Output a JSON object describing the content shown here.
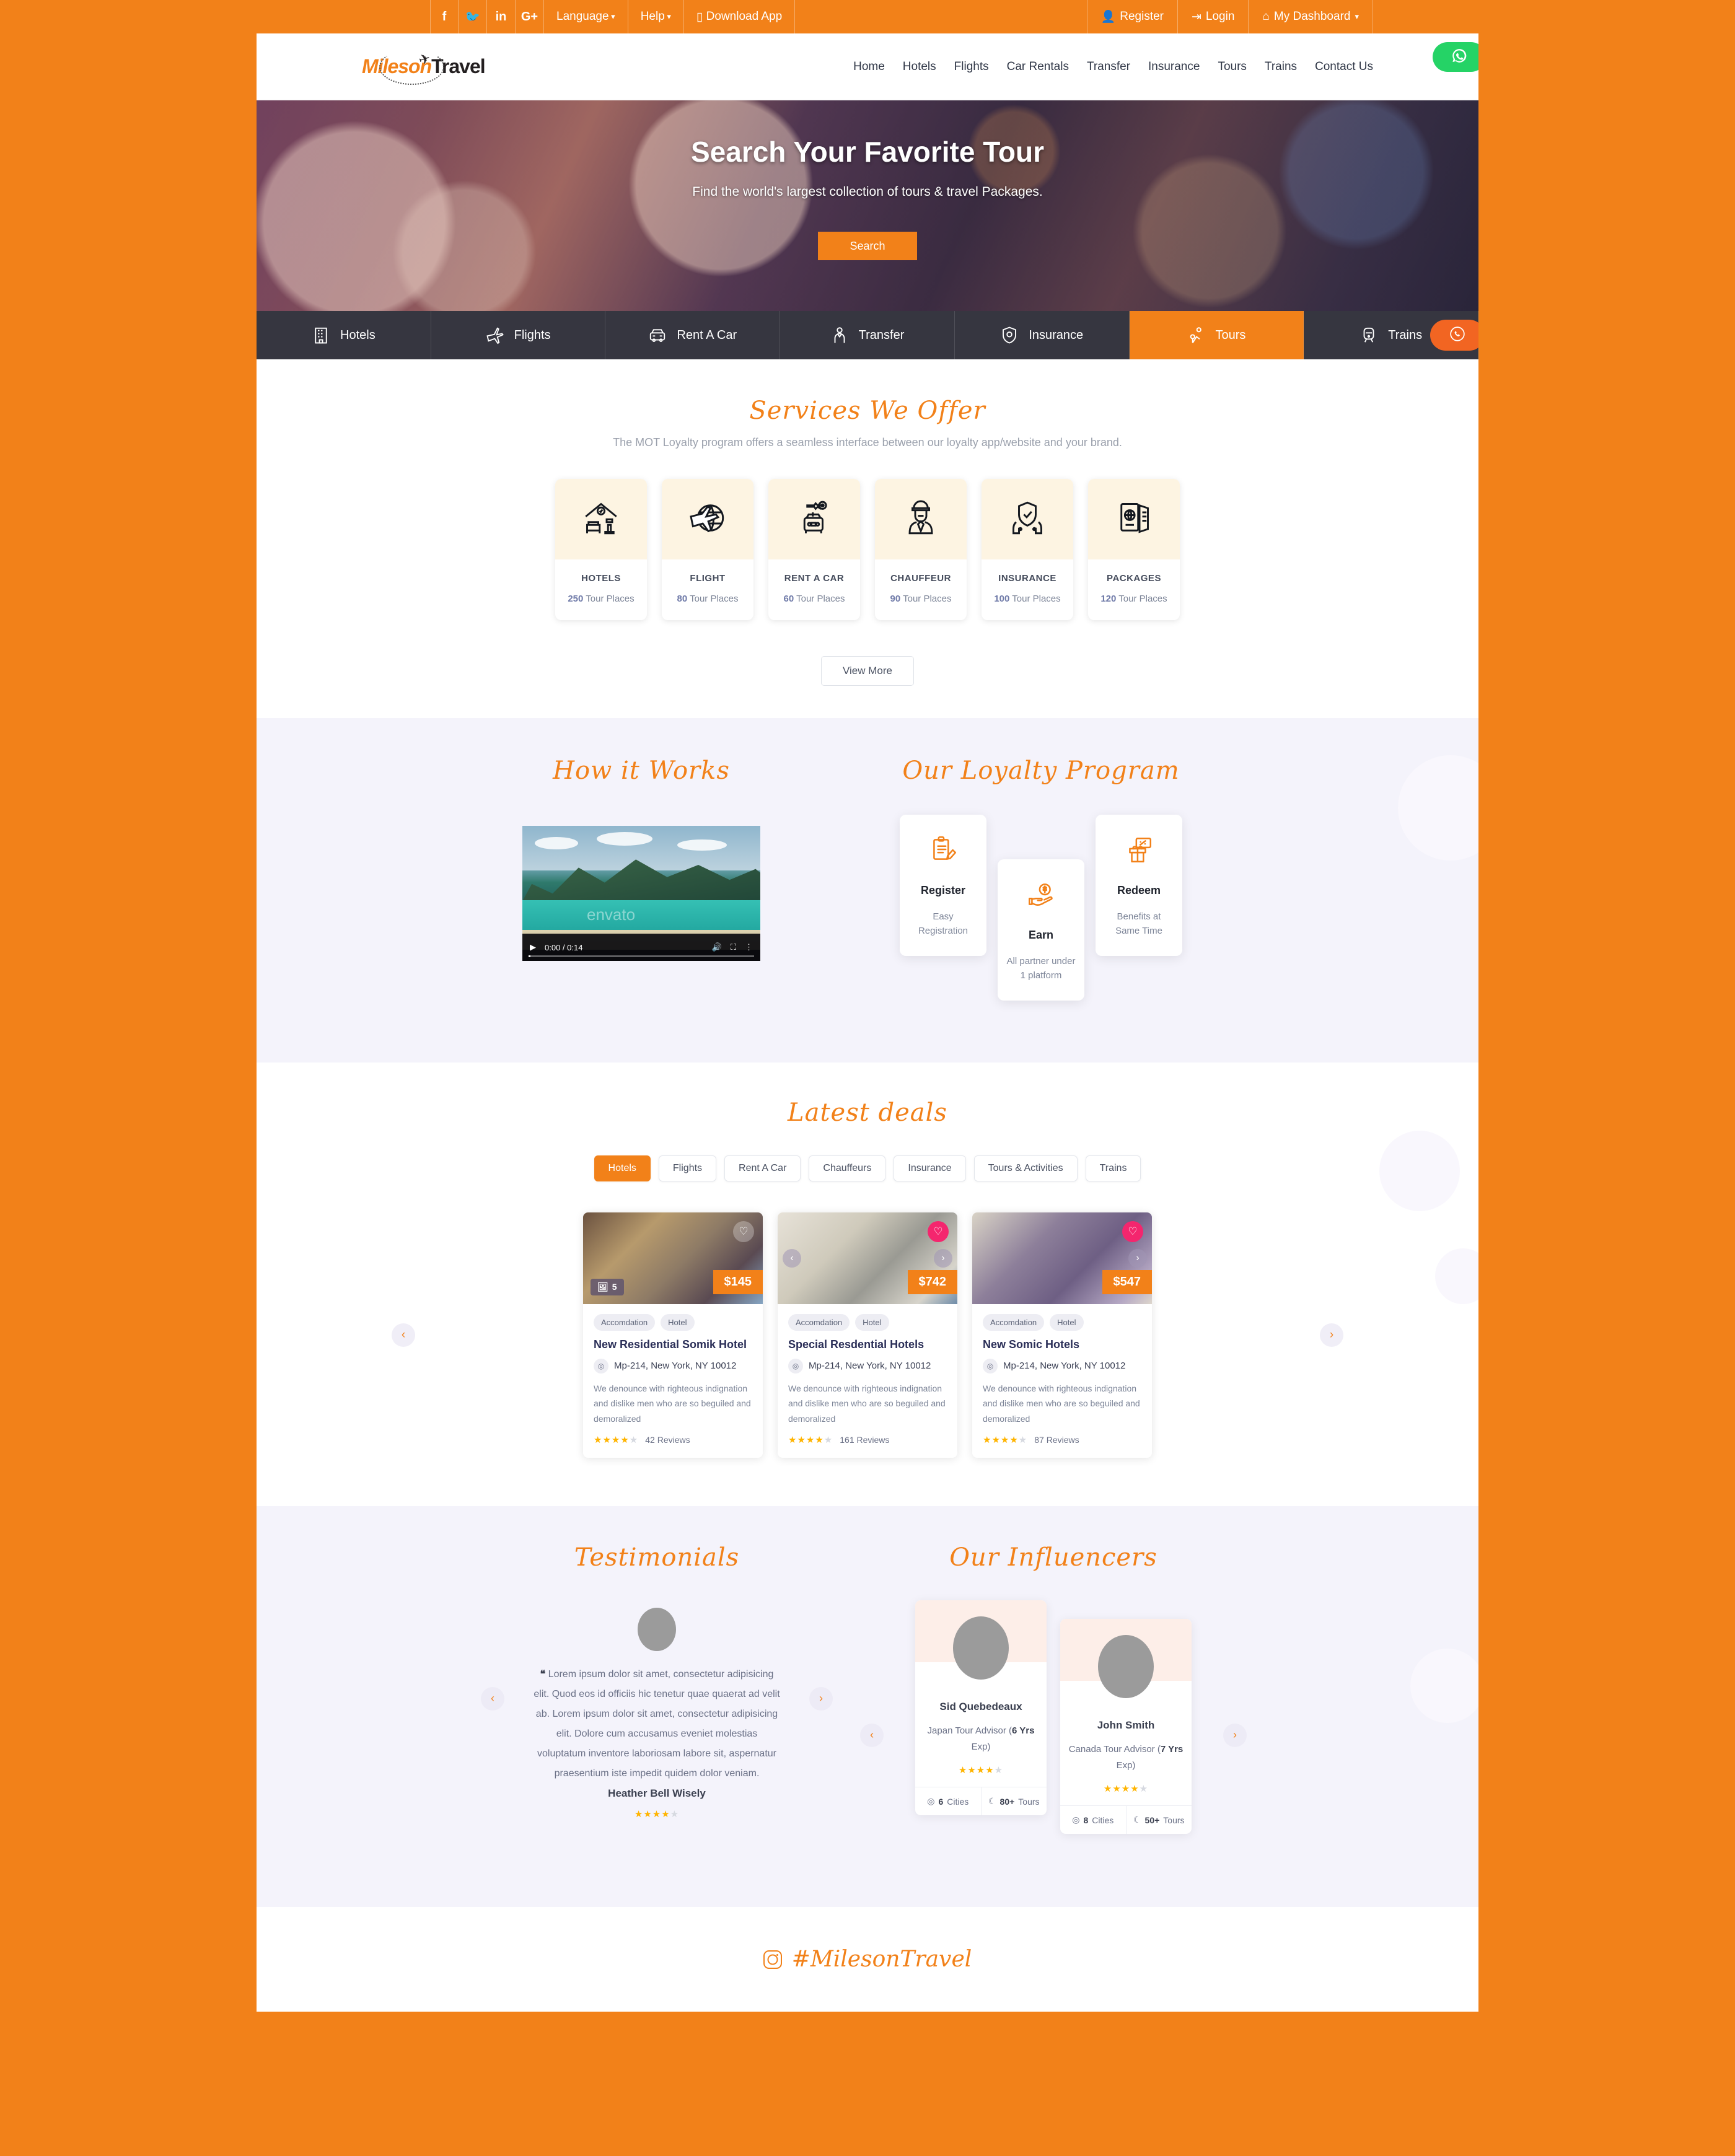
{
  "topbar": {
    "socials": [
      {
        "name": "facebook-icon",
        "glyph": "f"
      },
      {
        "name": "twitter-icon",
        "glyph": "🐦"
      },
      {
        "name": "linkedin-icon",
        "glyph": "in"
      },
      {
        "name": "google-plus-icon",
        "glyph": "G+"
      }
    ],
    "language_label": "Language",
    "help_label": "Help",
    "download_label": "Download App",
    "register_label": "Register",
    "login_label": "Login",
    "dashboard_label": "My Dashboard"
  },
  "header": {
    "logo": {
      "part1": "Miles",
      "part2": "on",
      "part3": "Travel"
    },
    "nav": [
      "Home",
      "Hotels",
      "Flights",
      "Car Rentals",
      "Transfer",
      "Insurance",
      "Tours",
      "Trains",
      "Contact Us"
    ]
  },
  "hero": {
    "title": "Search Your Favorite Tour",
    "subtitle": "Find the world's largest collection of tours & travel Packages.",
    "search_label": "Search"
  },
  "service_tabs": [
    {
      "label": "Hotels",
      "icon": "hotel-icon",
      "active": false
    },
    {
      "label": "Flights",
      "icon": "flight-icon",
      "active": false
    },
    {
      "label": "Rent A Car",
      "icon": "car-icon",
      "active": false
    },
    {
      "label": "Transfer",
      "icon": "transfer-icon",
      "active": false
    },
    {
      "label": "Insurance",
      "icon": "shield-icon",
      "active": false
    },
    {
      "label": "Tours",
      "icon": "tours-icon",
      "active": true
    },
    {
      "label": "Trains",
      "icon": "train-icon",
      "active": false
    }
  ],
  "floating": {
    "call_icon": "phone-icon",
    "whatsapp_icon": "whatsapp-icon"
  },
  "services": {
    "title": "Services We Offer",
    "subtitle": "The MOT Loyalty program offers a seamless interface between our loyalty app/website and your brand.",
    "cards": [
      {
        "name": "HOTELS",
        "count": "250",
        "unit": "Tour Places",
        "icon": "hotel-bed-icon"
      },
      {
        "name": "FLIGHT",
        "count": "80",
        "unit": "Tour Places",
        "icon": "globe-plane-icon"
      },
      {
        "name": "RENT A CAR",
        "count": "60",
        "unit": "Tour Places",
        "icon": "car-key-icon"
      },
      {
        "name": "CHAUFFEUR",
        "count": "90",
        "unit": "Tour Places",
        "icon": "chauffeur-icon"
      },
      {
        "name": "INSURANCE",
        "count": "100",
        "unit": "Tour Places",
        "icon": "shield-hands-icon"
      },
      {
        "name": "PACKAGES",
        "count": "120",
        "unit": "Tour Places",
        "icon": "passport-ticket-icon"
      }
    ],
    "view_more_label": "View More"
  },
  "how_it_works": {
    "title": "How it Works",
    "video": {
      "current_time": "0:00",
      "duration": "0:14",
      "time_label": "0:00 / 0:14",
      "watermark": "envato"
    }
  },
  "loyalty": {
    "title": "Our Loyalty Program",
    "cards": [
      {
        "title": "Register",
        "desc": "Easy Registration",
        "icon": "clipboard-pen-icon"
      },
      {
        "title": "Earn",
        "desc": "All partner under 1 platform",
        "icon": "hand-coin-icon"
      },
      {
        "title": "Redeem",
        "desc": "Benefits at Same Time",
        "icon": "gift-voucher-icon"
      }
    ]
  },
  "deals": {
    "title": "Latest deals",
    "tabs": [
      {
        "label": "Hotels",
        "active": true
      },
      {
        "label": "Flights",
        "active": false
      },
      {
        "label": "Rent A Car",
        "active": false
      },
      {
        "label": "Chauffeurs",
        "active": false
      },
      {
        "label": "Insurance",
        "active": false
      },
      {
        "label": "Tours & Activities",
        "active": false
      },
      {
        "label": "Trains",
        "active": false
      }
    ],
    "cards": [
      {
        "price": "$145",
        "photo_count": "5",
        "chips": [
          "Accomdation",
          "Hotel"
        ],
        "title": "New Residential Somik Hotel",
        "location": "Mp-214, New York, NY 10012",
        "description": "We denounce with righteous indignation and dislike men who are so beguiled and demoralized",
        "rating": 4,
        "reviews": "42 Reviews",
        "favorite": false
      },
      {
        "price": "$742",
        "photo_count": "",
        "chips": [
          "Accomdation",
          "Hotel"
        ],
        "title": "Special Resdential Hotels",
        "location": "Mp-214, New York, NY 10012",
        "description": "We denounce with righteous indignation and dislike men who are so beguiled and demoralized",
        "rating": 4,
        "reviews": "161 Reviews",
        "favorite": true
      },
      {
        "price": "$547",
        "photo_count": "",
        "chips": [
          "Accomdation",
          "Hotel"
        ],
        "title": "New Somic Hotels",
        "location": "Mp-214, New York, NY 10012",
        "description": "We denounce with righteous indignation and dislike men who are so beguiled and demoralized",
        "rating": 4,
        "reviews": "87 Reviews",
        "favorite": true
      }
    ]
  },
  "testimonials": {
    "title": "Testimonials",
    "quote": "Lorem ipsum dolor sit amet, consectetur adipisicing elit. Quod eos id officiis hic tenetur quae quaerat ad velit ab. Lorem ipsum dolor sit amet, consectetur adipisicing elit. Dolore cum accusamus eveniet molestias voluptatum inventore laboriosam labore sit, aspernatur praesentium iste impedit quidem dolor veniam.",
    "author": "Heather Bell Wisely",
    "rating": 4
  },
  "influencers": {
    "title": "Our Influencers",
    "cards": [
      {
        "name": "Sid Quebedeaux",
        "role_prefix": "Japan Tour Advisor (",
        "role_bold": "6 Yrs",
        "role_suffix": " Exp)",
        "rating": 4,
        "cities_value": "6",
        "cities_label": "Cities",
        "tours_value": "80+",
        "tours_label": "Tours"
      },
      {
        "name": "John Smith",
        "role_prefix": "Canada Tour Advisor (",
        "role_bold": "7 Yrs",
        "role_suffix": " Exp)",
        "rating": 4,
        "cities_value": "8",
        "cities_label": "Cities",
        "tours_value": "50+",
        "tours_label": "Tours"
      }
    ]
  },
  "instagram": {
    "hashtag": "#MilesonTravel",
    "icon": "instagram-icon"
  },
  "colors": {
    "brand_orange": "#F28119",
    "accent_pink": "#F4266E",
    "whatsapp_green": "#25D366",
    "star_gold": "#FFB400",
    "light_lavender": "#F4F3FB",
    "card_cream": "#FDF4E2"
  }
}
